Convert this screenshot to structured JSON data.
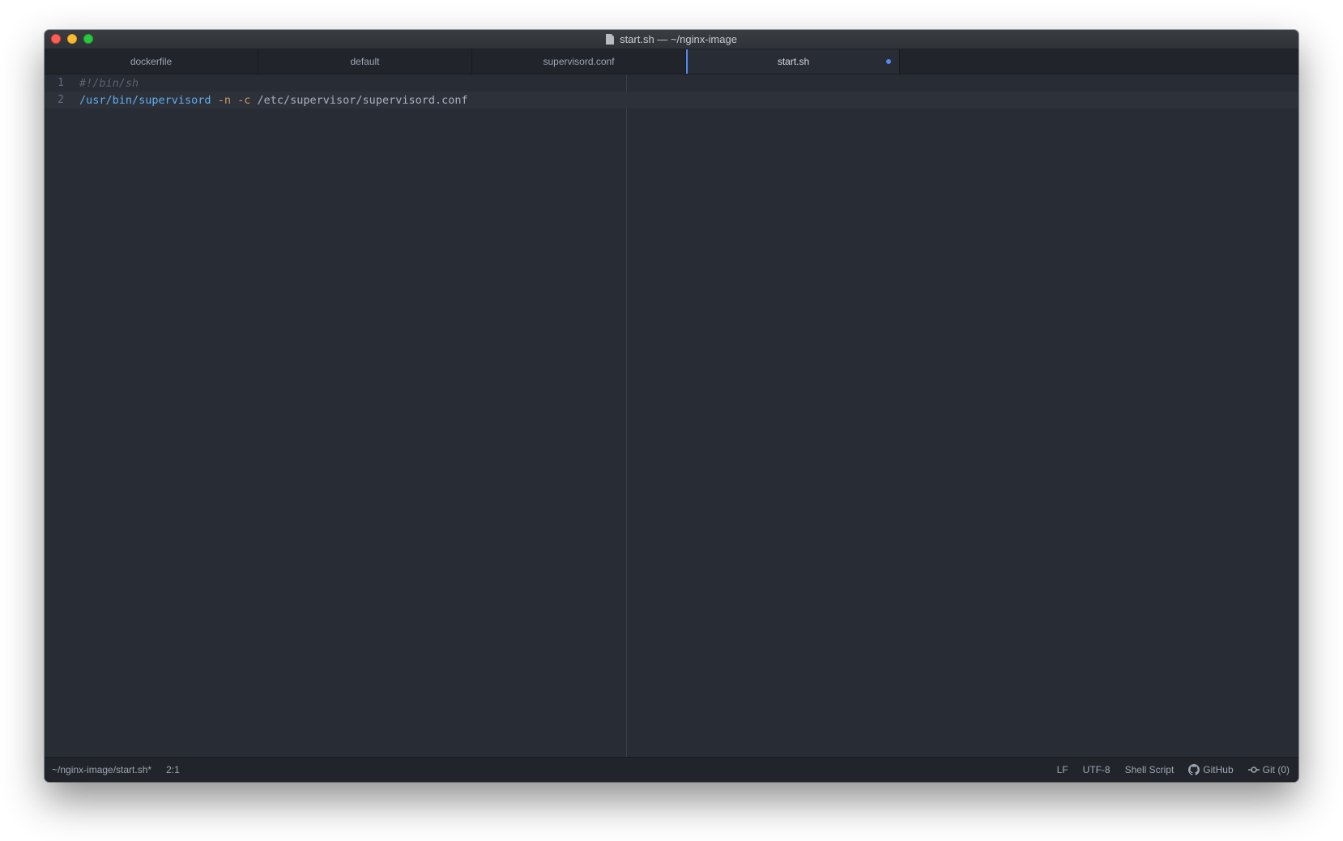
{
  "window": {
    "title": "start.sh — ~/nginx-image"
  },
  "tabs": [
    {
      "label": "dockerfile",
      "active": false
    },
    {
      "label": "default",
      "active": false
    },
    {
      "label": "supervisord.conf",
      "active": false
    },
    {
      "label": "start.sh",
      "active": true,
      "modified": true
    }
  ],
  "editor": {
    "lines": [
      {
        "number": "1",
        "comment": "#!/bin/sh"
      },
      {
        "number": "2",
        "command": "/usr/bin/supervisord",
        "flag1": "-n",
        "flag2": "-c",
        "arg": "/etc/supervisor/supervisord.conf"
      }
    ]
  },
  "status": {
    "path": "~/nginx-image/start.sh*",
    "cursor": "2:1",
    "line_ending": "LF",
    "encoding": "UTF-8",
    "grammar": "Shell Script",
    "github": "GitHub",
    "git": "Git (0)"
  },
  "colors": {
    "accent": "#568af2",
    "background": "#282c34",
    "panel": "#21252b"
  },
  "icons": [
    "file-icon",
    "github-icon",
    "git-commit-icon"
  ]
}
